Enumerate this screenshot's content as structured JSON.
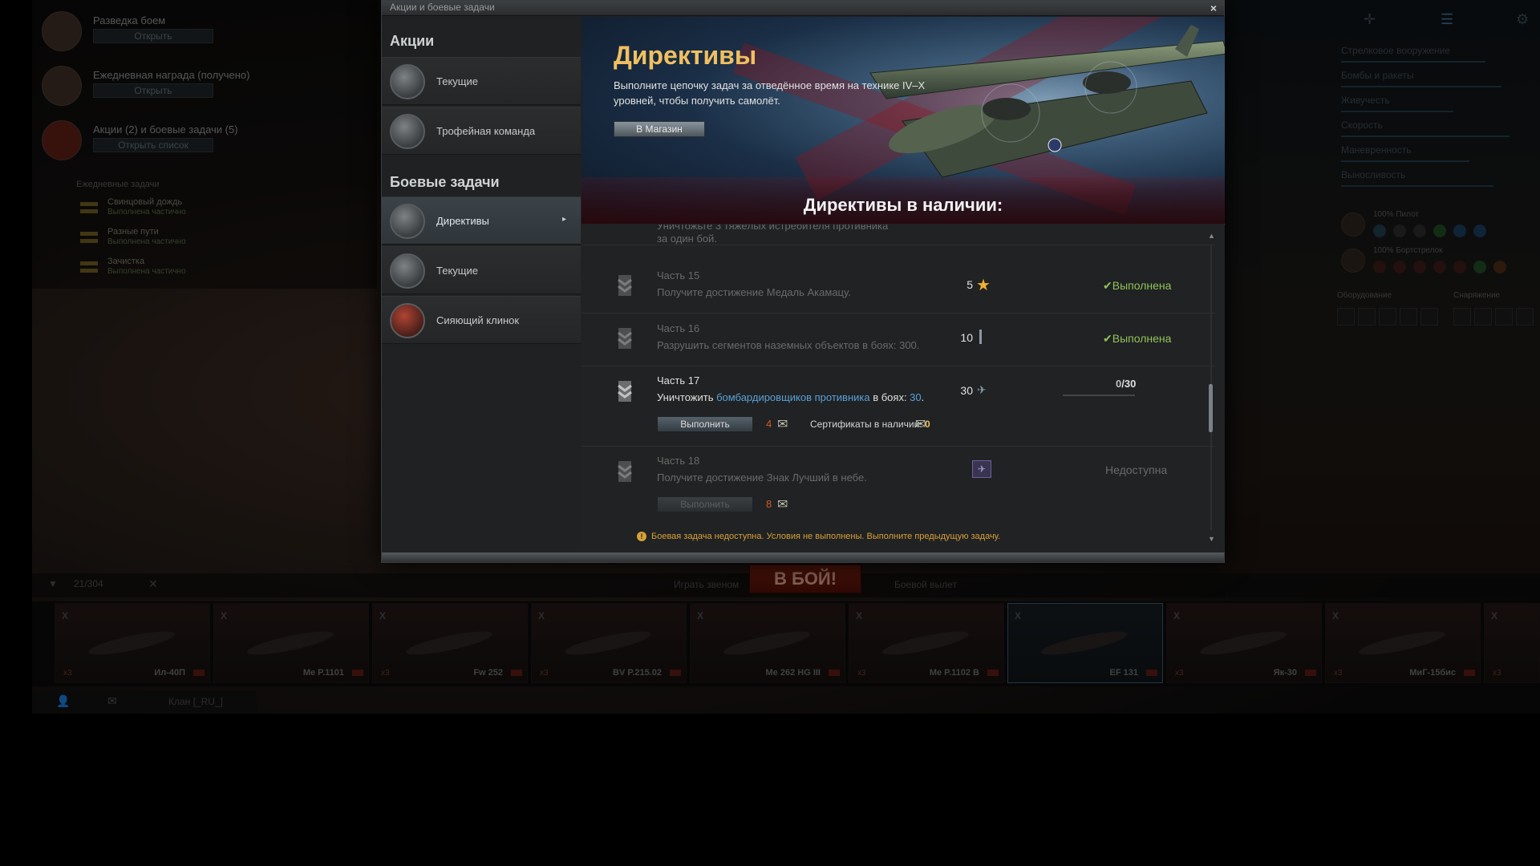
{
  "background": {
    "left_panel": {
      "rows": [
        {
          "title": "Разведка боем",
          "button": "Открыть"
        },
        {
          "title": "Ежедневная награда (получено)",
          "button": "Открыть"
        },
        {
          "title": "Акции (2) и боевые задачи (5)",
          "button": "Открыть список"
        }
      ],
      "daily_title": "Ежедневные задачи",
      "daily": [
        {
          "name": "Свинцовый дождь",
          "status": "Выполнена частично"
        },
        {
          "name": "Разные пути",
          "status": "Выполнена частично"
        },
        {
          "name": "Зачистка",
          "status": "Выполнена частично"
        }
      ]
    },
    "right_panel": {
      "items": [
        "Стрелковое вооружение",
        "Бомбы и ракеты",
        "Живучесть",
        "Скорость",
        "Маневренность",
        "Выносливость"
      ],
      "crew": [
        {
          "title": "100% Пилот"
        },
        {
          "title": "100% Бортстрелок"
        }
      ],
      "equipment_label": "Оборудование",
      "consumables_label": "Снаряжение"
    },
    "filter": {
      "count": "21/304",
      "play_label": "Играть звеном",
      "battle_label": "В БОЙ!",
      "mode_label": "Боевой вылет"
    },
    "carousel": [
      {
        "tier": "X",
        "name": "Ил-40П",
        "badge": "x3"
      },
      {
        "tier": "X",
        "name": "Me P.1101",
        "badge": ""
      },
      {
        "tier": "X",
        "name": "Fw 252",
        "badge": "x3"
      },
      {
        "tier": "X",
        "name": "BV P.215.02",
        "badge": "x3"
      },
      {
        "tier": "X",
        "name": "Me 262 HG III",
        "badge": ""
      },
      {
        "tier": "X",
        "name": "Me P.1102 B",
        "badge": "x3"
      },
      {
        "tier": "X",
        "name": "EF 131",
        "badge": ""
      },
      {
        "tier": "X",
        "name": "Як-30",
        "badge": "x3"
      },
      {
        "tier": "X",
        "name": "МиГ-15бис",
        "badge": "x3"
      },
      {
        "tier": "X",
        "name": "",
        "badge": "x3"
      }
    ],
    "chat_label": "Клан [_RU_]"
  },
  "dialog": {
    "title": "Акции и боевые задачи",
    "close": "×",
    "sidebar": {
      "promo_header": "Акции",
      "promo_items": [
        {
          "label": "Текущие"
        },
        {
          "label": "Трофейная команда"
        }
      ],
      "tasks_header": "Боевые задачи",
      "task_items": [
        {
          "label": "Директивы"
        },
        {
          "label": "Текущие"
        },
        {
          "label": "Сияющий клинок"
        }
      ],
      "active_arrow": "▸"
    },
    "banner": {
      "title": "Директивы",
      "description": "Выполните цепочку задач за отведённое время на технике IV–X уровней, чтобы получить самолёт.",
      "shop_button": "В Магазин",
      "subtitle": "Директивы в наличии:"
    },
    "tasks": {
      "partial_top": "Уничтожьте 3 тяжёлых истребителя противника за один бой.",
      "items": [
        {
          "part": "Часть 15",
          "desc": "Получите достижение Медаль Акамацу.",
          "reward": "5",
          "status": "Выполнена"
        },
        {
          "part": "Часть 16",
          "desc": "Разрушить сегментов наземных объектов в боях: 300.",
          "reward": "10",
          "status": "Выполнена"
        },
        {
          "part": "Часть 17",
          "desc_pre": "Уничтожить ",
          "desc_link": "бомбардировщиков противника",
          "desc_mid": " в боях: ",
          "desc_num": "30",
          "desc_end": ".",
          "reward": "30",
          "progress_cur": "0",
          "progress_total": "/30",
          "progress_value": 0,
          "button": "Выполнить",
          "cost": "4",
          "cert_label": "Сертификаты в наличии:",
          "cert_value": "0"
        },
        {
          "part": "Часть 18",
          "desc": "Получите достижение Знак Лучший в небе.",
          "status": "Недоступна",
          "button": "Выполнить",
          "cost": "8"
        }
      ],
      "warning": "Боевая задача недоступна. Условия не выполнены. Выполните предыдущую задачу.",
      "warning_icon": "!"
    },
    "scroll": {
      "up": "▲",
      "down": "▼"
    },
    "check": "✔"
  }
}
